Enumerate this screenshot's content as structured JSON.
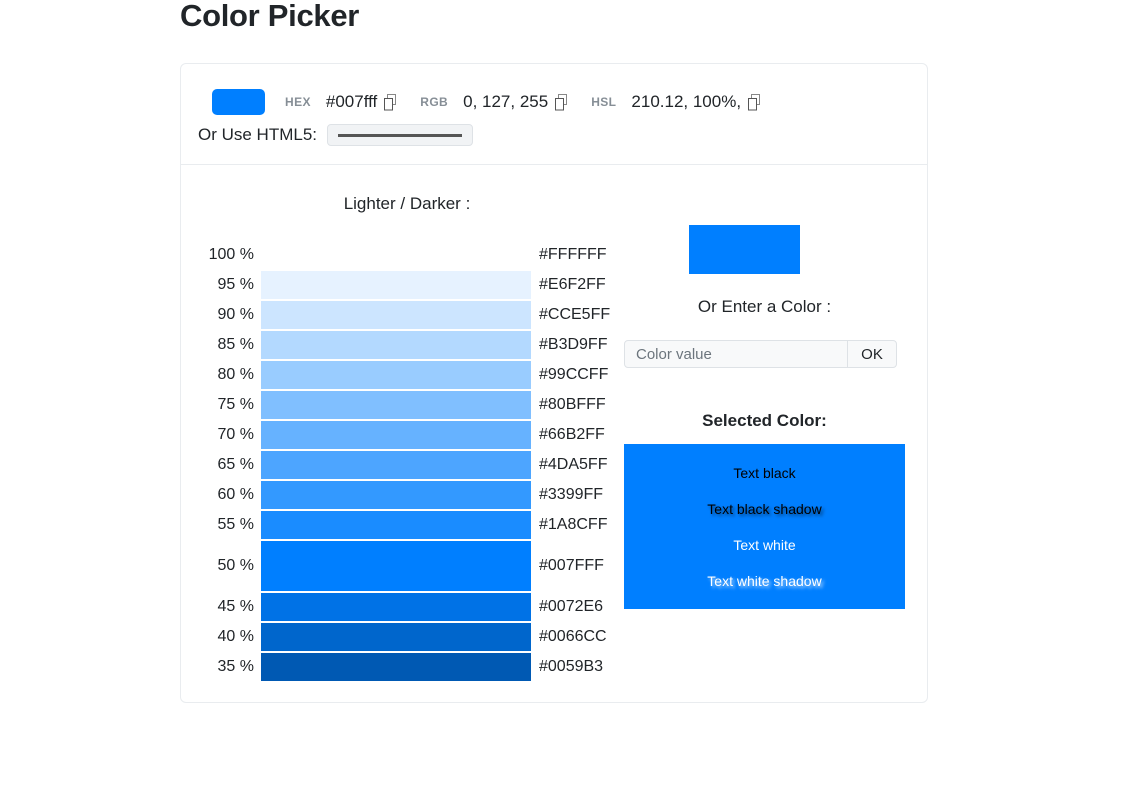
{
  "page": {
    "title": "Color Picker"
  },
  "header": {
    "swatch_color": "#007fff",
    "formats": [
      {
        "label": "HEX",
        "value": "#007fff",
        "copy_icon": "copy-icon"
      },
      {
        "label": "RGB",
        "value": "0, 127, 255",
        "copy_icon": "copy-icon"
      },
      {
        "label": "HSL",
        "value": "210.12, 100%,",
        "copy_icon": "copy-icon"
      }
    ],
    "html5_label": "Or Use HTML5:",
    "html5_input_value": "#007fff"
  },
  "shades_panel": {
    "title": "Lighter / Darker :",
    "rows": [
      {
        "pct": "100 %",
        "hex": "#FFFFFF",
        "color": "#FFFFFF",
        "base": false,
        "show_bar": false
      },
      {
        "pct": "95 %",
        "hex": "#E6F2FF",
        "color": "#E6F2FF",
        "base": false,
        "show_bar": true
      },
      {
        "pct": "90 %",
        "hex": "#CCE5FF",
        "color": "#CCE5FF",
        "base": false,
        "show_bar": true
      },
      {
        "pct": "85 %",
        "hex": "#B3D9FF",
        "color": "#B3D9FF",
        "base": false,
        "show_bar": true
      },
      {
        "pct": "80 %",
        "hex": "#99CCFF",
        "color": "#99CCFF",
        "base": false,
        "show_bar": true
      },
      {
        "pct": "75 %",
        "hex": "#80BFFF",
        "color": "#80BFFF",
        "base": false,
        "show_bar": true
      },
      {
        "pct": "70 %",
        "hex": "#66B2FF",
        "color": "#66B2FF",
        "base": false,
        "show_bar": true
      },
      {
        "pct": "65 %",
        "hex": "#4DA5FF",
        "color": "#4DA5FF",
        "base": false,
        "show_bar": true
      },
      {
        "pct": "60 %",
        "hex": "#3399FF",
        "color": "#3399FF",
        "base": false,
        "show_bar": true
      },
      {
        "pct": "55 %",
        "hex": "#1A8CFF",
        "color": "#1A8CFF",
        "base": false,
        "show_bar": true
      },
      {
        "pct": "50 %",
        "hex": "#007FFF",
        "color": "#007FFF",
        "base": true,
        "show_bar": true
      },
      {
        "pct": "45 %",
        "hex": "#0072E6",
        "color": "#0072E6",
        "base": false,
        "show_bar": true
      },
      {
        "pct": "40 %",
        "hex": "#0066CC",
        "color": "#0066CC",
        "base": false,
        "show_bar": true
      },
      {
        "pct": "35 %",
        "hex": "#0059B3",
        "color": "#0059B3",
        "base": false,
        "show_bar": true
      }
    ]
  },
  "right_panel": {
    "preview_color": "#007fff",
    "enter_color_label": "Or Enter a Color :",
    "color_value_placeholder": "Color value",
    "color_value": "",
    "ok_label": "OK",
    "selected_title": "Selected Color:",
    "selected_color": "#007fff",
    "samples": [
      {
        "text": "Text black",
        "style": "t-black"
      },
      {
        "text": "Text black shadow",
        "style": "t-black-shadow"
      },
      {
        "text": "Text white",
        "style": "t-white"
      },
      {
        "text": "Text white shadow",
        "style": "t-white-shadow"
      }
    ]
  }
}
